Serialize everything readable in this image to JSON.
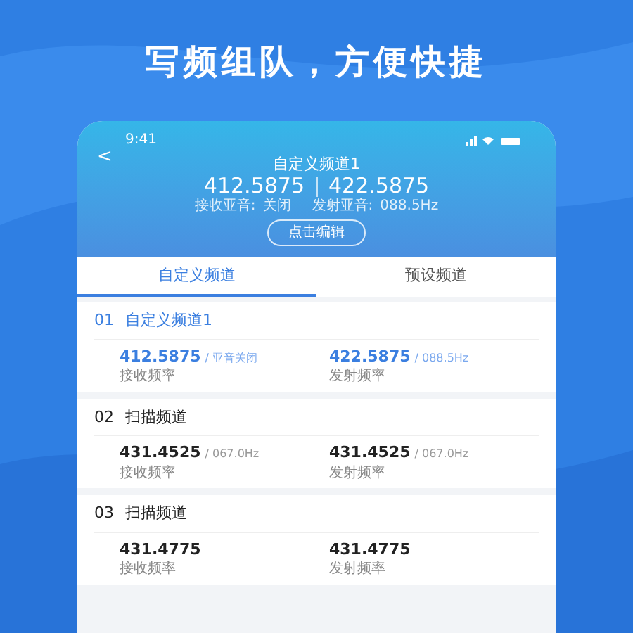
{
  "headline": "写频组队，方便快捷",
  "status_bar": {
    "time": "9:41"
  },
  "header": {
    "back": "<",
    "title": "自定义频道1",
    "rx": "412.5875",
    "tx": "422.5875",
    "rx_tone_label": "接收亚音:",
    "rx_tone": "关闭",
    "tx_tone_label": "发射亚音:",
    "tx_tone": "088.5Hz",
    "edit_button": "点击编辑"
  },
  "tabs": [
    {
      "label": "自定义频道",
      "selected": true
    },
    {
      "label": "预设频道",
      "selected": false
    }
  ],
  "channels": [
    {
      "number": "01",
      "name": "自定义频道1",
      "selected": true,
      "rx": "412.5875",
      "rx_tone": "/ 亚音关闭",
      "rx_label": "接收频率",
      "tx": "422.5875",
      "tx_tone": "/ 088.5Hz",
      "tx_label": "发射频率"
    },
    {
      "number": "02",
      "name": "扫描频道",
      "selected": false,
      "rx": "431.4525",
      "rx_tone": "/ 067.0Hz",
      "rx_label": "接收频率",
      "tx": "431.4525",
      "tx_tone": "/ 067.0Hz",
      "tx_label": "发射频率"
    },
    {
      "number": "03",
      "name": "扫描频道",
      "selected": false,
      "rx": "431.4775",
      "rx_label": "接收频率",
      "tx": "431.4775",
      "tx_label": "发射频率"
    }
  ]
}
